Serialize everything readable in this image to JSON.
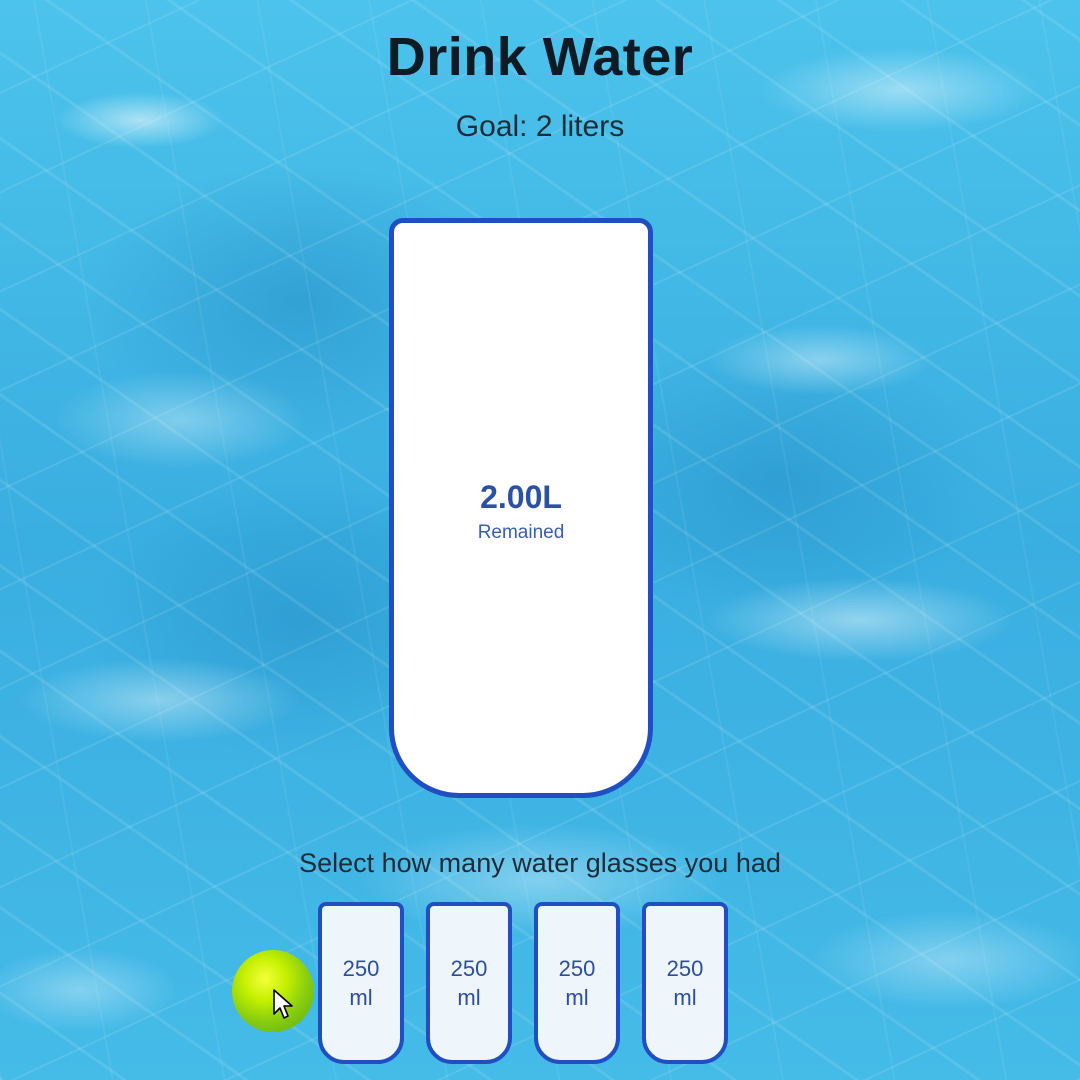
{
  "app": {
    "title": "Drink Water",
    "goal": "Goal: 2 liters"
  },
  "big_cup": {
    "liters": "2.00L",
    "label": "Remained"
  },
  "instruction": "Select how many water glasses you had",
  "small_cups": [
    {
      "label": "250\nml"
    },
    {
      "label": "250\nml"
    },
    {
      "label": "250\nml"
    },
    {
      "label": "250\nml"
    }
  ],
  "colors": {
    "accent": "#1f4fc2",
    "cup_text": "#2b50a8",
    "water_bg": "#3fb6e3"
  },
  "icons": {
    "cursor": "arrow-cursor-icon",
    "click_indicator": "click-highlight-icon"
  }
}
